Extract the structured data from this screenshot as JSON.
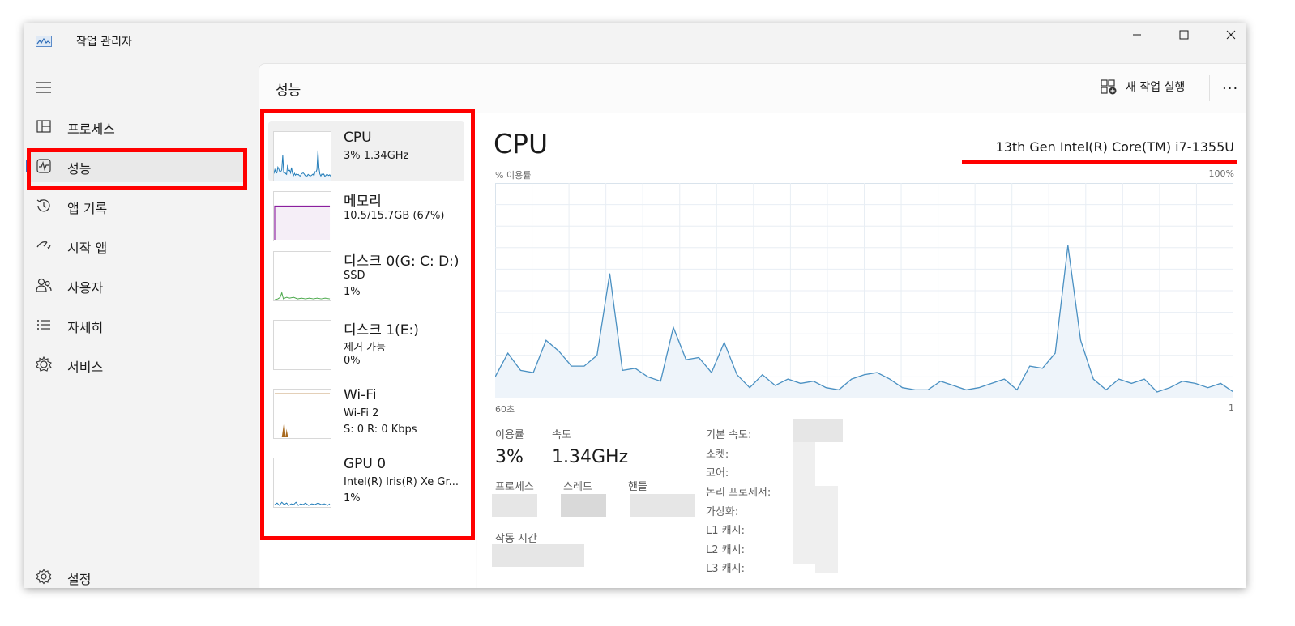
{
  "app": {
    "title": "작업 관리자"
  },
  "sidebar": {
    "items": [
      {
        "label": "프로세스",
        "icon": "processes-icon"
      },
      {
        "label": "성능",
        "icon": "performance-icon",
        "active": true
      },
      {
        "label": "앱 기록",
        "icon": "app-history-icon"
      },
      {
        "label": "시작 앱",
        "icon": "startup-apps-icon"
      },
      {
        "label": "사용자",
        "icon": "users-icon"
      },
      {
        "label": "자세히",
        "icon": "details-icon"
      },
      {
        "label": "서비스",
        "icon": "services-icon"
      }
    ],
    "settings_label": "설정"
  },
  "header": {
    "title": "성능",
    "new_task_label": "새 작업 실행",
    "more_label": "···"
  },
  "devices": [
    {
      "name": "CPU",
      "line2": "3% 1.34GHz",
      "line3": "",
      "color": "#1f7bb8"
    },
    {
      "name": "메모리",
      "line2": "10.5/15.7GB (67%)",
      "line3": "",
      "color": "#8b1e9e"
    },
    {
      "name": "디스크 0(G: C: D:)",
      "line2": "SSD",
      "line3": "1%",
      "color": "#4aa84a"
    },
    {
      "name": "디스크 1(E:)",
      "line2": "제거 가능",
      "line3": "0%",
      "color": "#4aa84a"
    },
    {
      "name": "Wi-Fi",
      "line2": "Wi-Fi 2",
      "line3": "S: 0 R: 0 Kbps",
      "color": "#a86a1f"
    },
    {
      "name": "GPU 0",
      "line2": "Intel(R) Iris(R) Xe Gr...",
      "line3": "1%",
      "color": "#1f7bb8"
    }
  ],
  "detail": {
    "title": "CPU",
    "model": "13th Gen Intel(R) Core(TM) i7-1355U",
    "usage_label": "% 이용률",
    "max_label": "100%",
    "time_left": "60초",
    "time_right": "1",
    "stats": {
      "usage_label": "이용률",
      "usage_value": "3%",
      "speed_label": "속도",
      "speed_value": "1.34GHz",
      "processes_label": "프로세스",
      "threads_label": "스레드",
      "handles_label": "핸들",
      "uptime_label": "작동 시간"
    },
    "specs": {
      "base_speed": "기본 속도:",
      "sockets": "소켓:",
      "cores": "코어:",
      "logical": "논리 프로세서:",
      "virtualization": "가상화:",
      "l1": "L1 캐시:",
      "l2": "L2 캐시:",
      "l3": "L3 캐시:"
    }
  },
  "chart_data": {
    "type": "area",
    "title": "",
    "xlabel": "",
    "ylabel": "% 이용률",
    "ylim": [
      0,
      100
    ],
    "x_ticks": [
      "60초",
      "1"
    ],
    "grid": true,
    "series": [
      {
        "color": "#4a90c2",
        "values": [
          10,
          21,
          13,
          12,
          27,
          22,
          15,
          15,
          20,
          58,
          13,
          14,
          10,
          8,
          33,
          18,
          19,
          12,
          26,
          11,
          5,
          11,
          6,
          9,
          7,
          8,
          5,
          4,
          9,
          11,
          12,
          9,
          5,
          4,
          4,
          8,
          6,
          4,
          5,
          7,
          9,
          4,
          15,
          14,
          21,
          71,
          27,
          9,
          4,
          9,
          7,
          9,
          3,
          5,
          8,
          7,
          5,
          7,
          3
        ]
      }
    ]
  },
  "colors": {
    "accent": "#3a6dc5",
    "highlight": "#ff0000",
    "graph_line": "#4a90c2",
    "graph_fill": "#eef4fa"
  }
}
